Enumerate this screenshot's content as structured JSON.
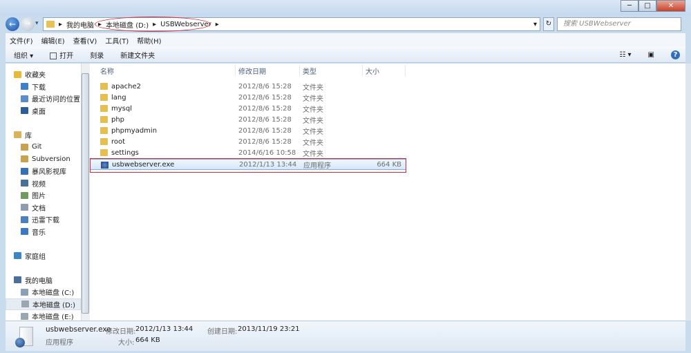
{
  "window": {
    "minimize": "─",
    "maximize": "□",
    "close": "✕"
  },
  "address": {
    "path": [
      "我的电脑",
      "本地磁盘 (D:)",
      "USBWebserver"
    ],
    "separator": "▸",
    "search_placeholder": "搜索 USBWebserver",
    "refresh": "↻",
    "dropdown": "▾"
  },
  "menu": [
    "文件(F)",
    "编辑(E)",
    "查看(V)",
    "工具(T)",
    "帮助(H)"
  ],
  "toolbar": {
    "organize": "组织 ▾",
    "open": "打开",
    "burn": "刻录",
    "new_folder": "新建文件夹",
    "views": "☷ ▾",
    "preview": "▣",
    "help": "?"
  },
  "sidebar": [
    {
      "label": "收藏夹",
      "type": "head",
      "icon": "star-icon",
      "color": "#e9b93a"
    },
    {
      "label": "下载",
      "type": "sub",
      "icon": "download-icon",
      "color": "#3f7fc8"
    },
    {
      "label": "最近访问的位置",
      "type": "sub",
      "icon": "recent-icon",
      "color": "#5b8ec6"
    },
    {
      "label": "桌面",
      "type": "sub",
      "icon": "desktop-icon",
      "color": "#2d5c9a"
    },
    {
      "label": "",
      "type": "gap"
    },
    {
      "label": "库",
      "type": "head",
      "icon": "library-icon",
      "color": "#d9b45a"
    },
    {
      "label": "Git",
      "type": "sub",
      "icon": "library-icon",
      "color": "#c9a250"
    },
    {
      "label": "Subversion",
      "type": "sub",
      "icon": "library-icon",
      "color": "#c9a250"
    },
    {
      "label": "暴风影视库",
      "type": "sub",
      "icon": "video-icon",
      "color": "#3370b8"
    },
    {
      "label": "视频",
      "type": "sub",
      "icon": "video-icon",
      "color": "#4a6f99"
    },
    {
      "label": "图片",
      "type": "sub",
      "icon": "picture-icon",
      "color": "#6f9b5f"
    },
    {
      "label": "文档",
      "type": "sub",
      "icon": "document-icon",
      "color": "#8c9db3"
    },
    {
      "label": "迅雷下载",
      "type": "sub",
      "icon": "download-icon",
      "color": "#4a80c0"
    },
    {
      "label": "音乐",
      "type": "sub",
      "icon": "music-icon",
      "color": "#3b79c4"
    },
    {
      "label": "",
      "type": "gap"
    },
    {
      "label": "家庭组",
      "type": "head",
      "icon": "homegroup-icon",
      "color": "#3c86c8"
    },
    {
      "label": "",
      "type": "gap"
    },
    {
      "label": "我的电脑",
      "type": "head",
      "icon": "computer-icon",
      "color": "#4b6f9a"
    },
    {
      "label": "本地磁盘 (C:)",
      "type": "sub",
      "icon": "drive-icon",
      "color": "#8aa0b6"
    },
    {
      "label": "本地磁盘 (D:)",
      "type": "sub sel",
      "icon": "drive-icon",
      "color": "#9aa6b2"
    },
    {
      "label": "本地磁盘 (E:)",
      "type": "sub",
      "icon": "drive-icon",
      "color": "#9aa6b2"
    }
  ],
  "columns": [
    "名称",
    "修改日期",
    "类型",
    "大小"
  ],
  "files": [
    {
      "name": "apache2",
      "date": "2012/8/6 15:28",
      "type": "文件夹",
      "size": "",
      "icon": "folder-icon"
    },
    {
      "name": "lang",
      "date": "2012/8/6 15:28",
      "type": "文件夹",
      "size": "",
      "icon": "folder-icon"
    },
    {
      "name": "mysql",
      "date": "2012/8/6 15:28",
      "type": "文件夹",
      "size": "",
      "icon": "folder-icon"
    },
    {
      "name": "php",
      "date": "2012/8/6 15:28",
      "type": "文件夹",
      "size": "",
      "icon": "folder-icon"
    },
    {
      "name": "phpmyadmin",
      "date": "2012/8/6 15:28",
      "type": "文件夹",
      "size": "",
      "icon": "folder-icon"
    },
    {
      "name": "root",
      "date": "2012/8/6 15:28",
      "type": "文件夹",
      "size": "",
      "icon": "folder-icon"
    },
    {
      "name": "settings",
      "date": "2014/6/16 10:58",
      "type": "文件夹",
      "size": "",
      "icon": "folder-icon"
    },
    {
      "name": "usbwebserver.exe",
      "date": "2012/1/13 13:44",
      "type": "应用程序",
      "size": "664 KB",
      "icon": "exe-icon",
      "selected": true
    }
  ],
  "details": {
    "name": "usbwebserver.exe",
    "type": "应用程序",
    "modified_label": "修改日期:",
    "modified": "2012/1/13 13:44",
    "size_label": "大小:",
    "size": "664 KB",
    "created_label": "创建日期:",
    "created": "2013/11/19 23:21"
  },
  "colors": {
    "highlight": "#d02b35",
    "selection": "#d6e7fa"
  }
}
